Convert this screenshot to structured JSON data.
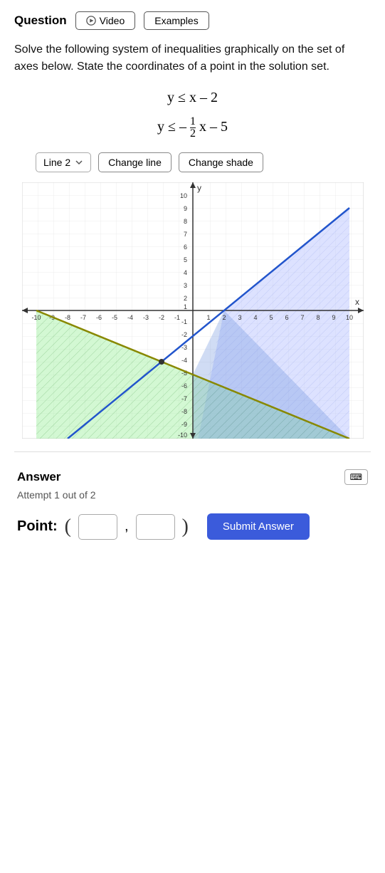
{
  "header": {
    "title": "Question",
    "video_label": "Video",
    "examples_label": "Examples"
  },
  "question": {
    "text": "Solve the following system of inequalities graphically on the set of axes below. State the coordinates of a point in the solution set."
  },
  "inequalities": {
    "line1": "y ≤ x – 2",
    "line2_prefix": "y ≤ –",
    "line2_frac_num": "1",
    "line2_frac_den": "2",
    "line2_suffix": "x – 5"
  },
  "controls": {
    "line_selector_label": "Line 2",
    "change_line_label": "Change line",
    "change_shade_label": "Change shade"
  },
  "answer": {
    "title": "Answer",
    "attempt_text": "Attempt 1 out of 2",
    "point_label": "Point:",
    "submit_label": "Submit Answer",
    "input1_placeholder": "",
    "input2_placeholder": ""
  },
  "colors": {
    "accent": "#3b5bdb",
    "blue_shade": "rgba(180,190,240,0.5)",
    "green_shade": "rgba(150,220,160,0.45)"
  }
}
